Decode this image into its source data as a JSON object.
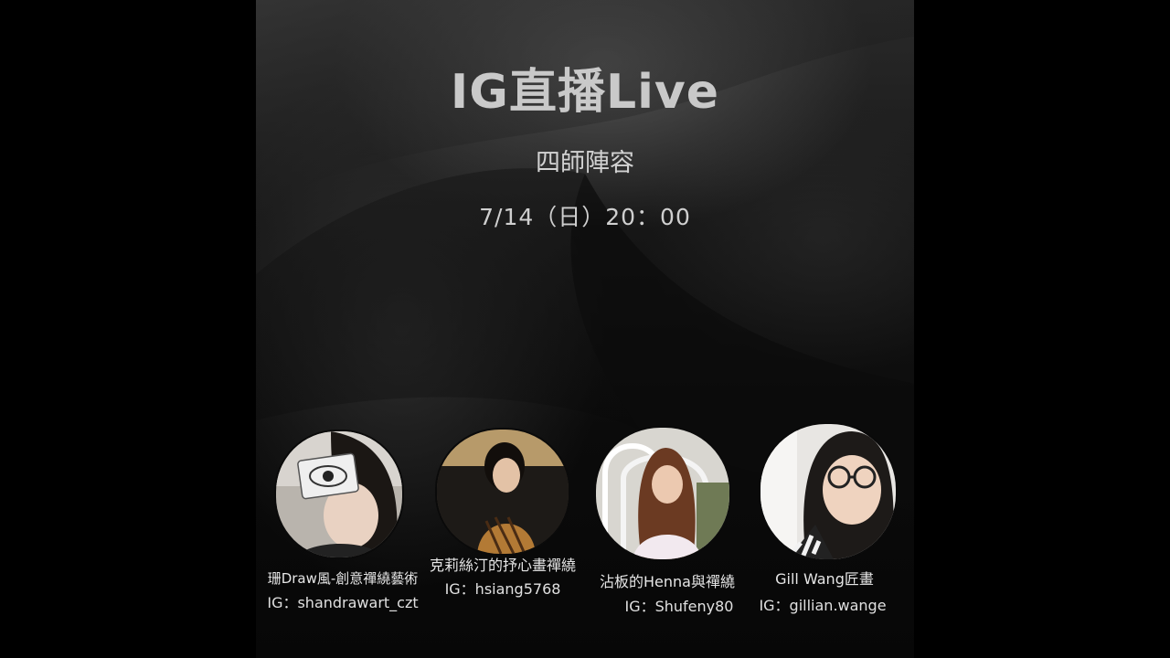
{
  "poster": {
    "title": "IG直播Live",
    "subtitle": "四師陣容",
    "datetime": "7/14（日）20：00"
  },
  "hosts": [
    {
      "name": "珊Draw風-創意禪繞藝術",
      "ig": "IG：shandrawart_czt"
    },
    {
      "name": "克莉絲汀的抒心畫禪繞",
      "ig": "IG：hsiang5768"
    },
    {
      "name": "沾板的Henna與禪繞",
      "ig": "IG：Shufeny80"
    },
    {
      "name": "Gill Wang匠畫",
      "ig": "IG：gillian.wange"
    }
  ],
  "colors": {
    "background": "#000000",
    "text": "#d2d2d2"
  }
}
